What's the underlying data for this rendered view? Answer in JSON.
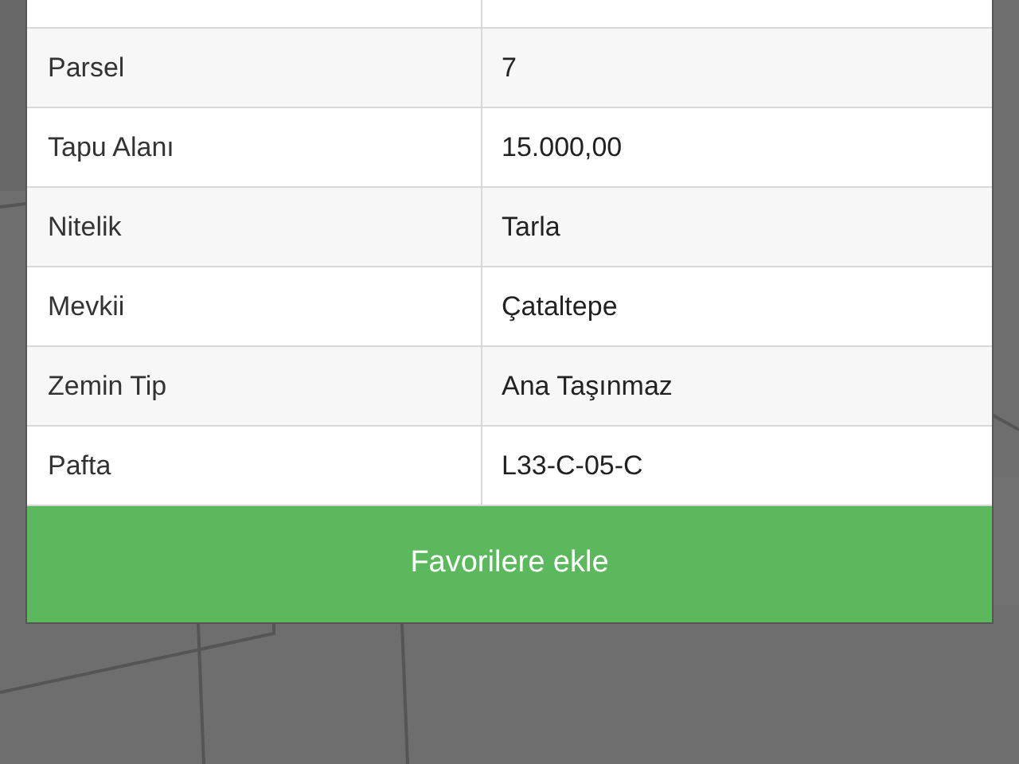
{
  "rows": [
    {
      "label": "Parsel",
      "value": "7"
    },
    {
      "label": "Tapu Alanı",
      "value": "15.000,00"
    },
    {
      "label": "Nitelik",
      "value": "Tarla"
    },
    {
      "label": "Mevkii",
      "value": "Çataltepe"
    },
    {
      "label": "Zemin Tip",
      "value": "Ana Taşınmaz"
    },
    {
      "label": "Pafta",
      "value": "L33-C-05-C"
    }
  ],
  "button": "Favorilere ekle"
}
